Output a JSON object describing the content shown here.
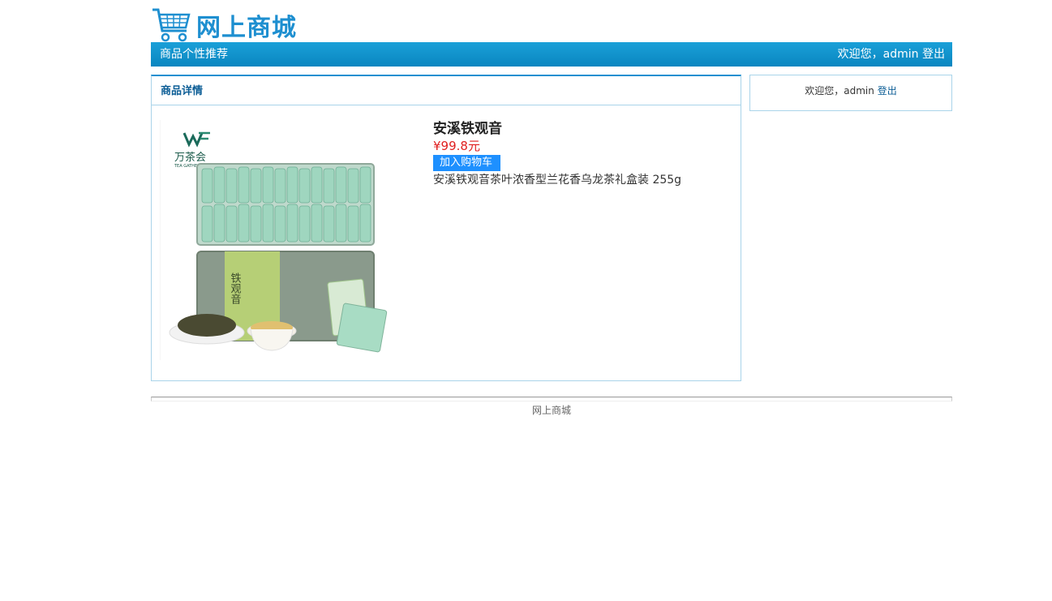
{
  "header": {
    "logo_text": "网上商城",
    "nav_left": "商品个性推荐",
    "welcome": "欢迎您，admin",
    "logout": "登出"
  },
  "main": {
    "title": "商品详情",
    "product": {
      "name": "安溪铁观音",
      "price": "¥99.8元",
      "add_to_cart": "加入购物车",
      "description": "安溪铁观音茶叶浓香型兰花香乌龙茶礼盒装 255g",
      "image_label_brand": "万茶会",
      "image_label_brand_en": "TEA GATHERING",
      "image_label_product": "铁观音"
    }
  },
  "sidebar": {
    "welcome": "欢迎您，admin",
    "logout": "登出"
  },
  "footer": {
    "text": "网上商城"
  },
  "colors": {
    "accent": "#1e8fd0",
    "nav_bg": "#0a86c0",
    "price": "#e02020",
    "button": "#1e90ff",
    "border": "#a9d4ea"
  }
}
